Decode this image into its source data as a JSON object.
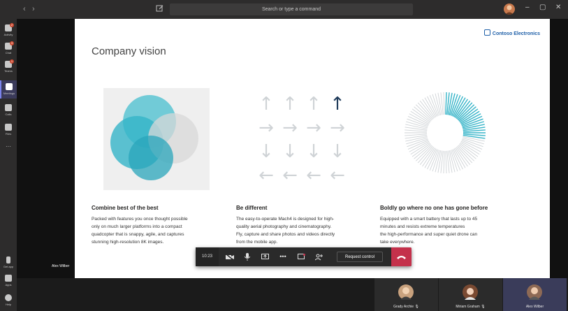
{
  "titlebar": {
    "back": "‹",
    "forward": "›",
    "search_placeholder": "Search or type a command",
    "minimize": "–",
    "maximize": "▢",
    "close": "✕"
  },
  "rail": {
    "items": [
      {
        "label": "Activity",
        "badge": "2"
      },
      {
        "label": "Chat",
        "badge": "3"
      },
      {
        "label": "Teams",
        "badge": "1"
      },
      {
        "label": "Meetings",
        "badge": ""
      },
      {
        "label": "Calls",
        "badge": ""
      },
      {
        "label": "Files",
        "badge": ""
      }
    ],
    "more": "···",
    "bottom": [
      {
        "label": "Get app"
      },
      {
        "label": "Apps"
      },
      {
        "label": "Help"
      }
    ]
  },
  "slide": {
    "title": "Company vision",
    "brand": "Contoso Electronics",
    "columns": [
      {
        "title": "Combine best of the best",
        "lines": [
          "Packed with features you once thought possible",
          "only on much larger platforms into a compact",
          "quadcopter that is snappy, agile, and captures",
          "stunning high-resolution 8K images."
        ]
      },
      {
        "title": "Be different",
        "lines": [
          "The easy-to-operate Mach4 is designed for high-",
          "quality aerial photography and cinematography.",
          "Fly, capture and share photos and videos directly",
          "from the mobile app."
        ]
      },
      {
        "title": "Boldly go where no one has gone before",
        "lines": [
          "Equipped with a smart battery that lasts up to 45",
          "minutes and resists extreme temperatures",
          "the high-performance and super quiet drone can",
          "take everywhere."
        ]
      }
    ]
  },
  "stage": {
    "speaker_name": "Alex Wilber"
  },
  "callbar": {
    "timer": "10:23",
    "request_control": "Request control"
  },
  "participants": [
    {
      "name": "Grady Archie",
      "color": "#a36a3c"
    },
    {
      "name": "Miriam Graham",
      "color": "#7a4a32"
    },
    {
      "name": "Alex Wilber",
      "color": "#8e6a55"
    }
  ],
  "colors": {
    "accent": "#7b83eb",
    "hangup": "#c4314b",
    "teal": "#35b4c8",
    "brand": "#1e5fa8"
  }
}
